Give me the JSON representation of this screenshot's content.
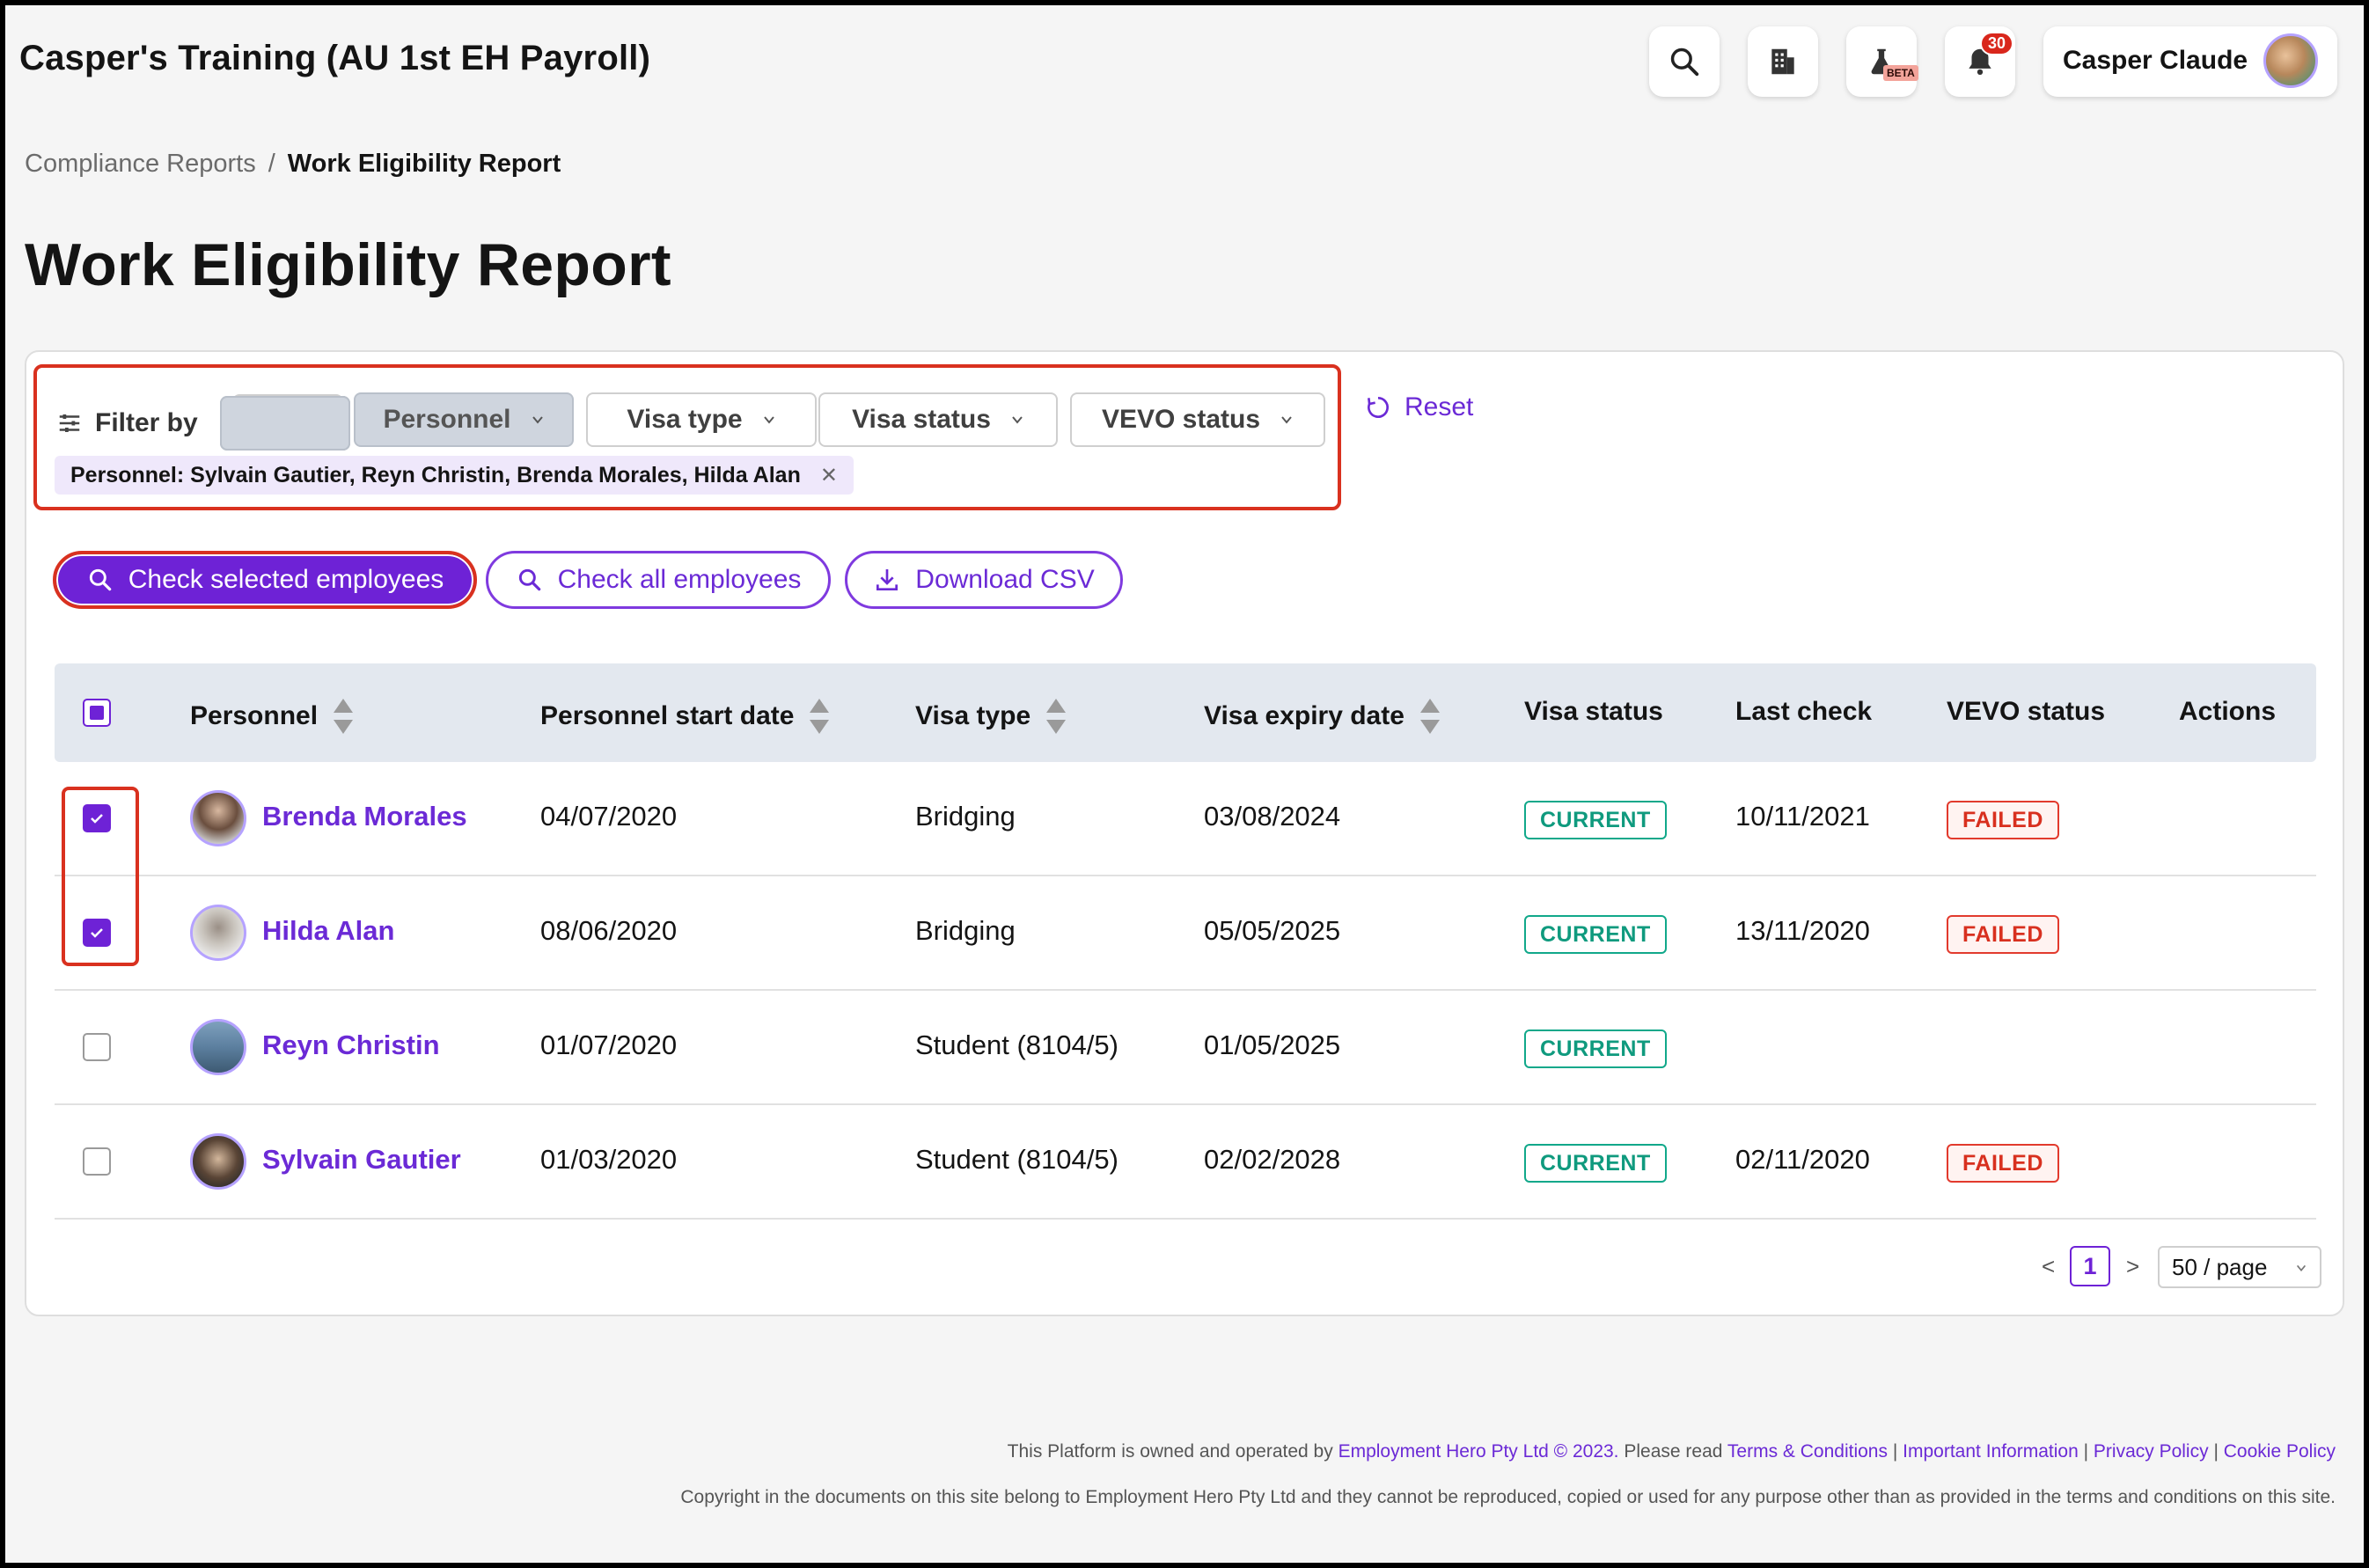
{
  "header": {
    "app_title": "Casper's Training (AU 1st EH Payroll)",
    "beta_label": "BETA",
    "notification_count": "30",
    "user_name": "Casper Claude"
  },
  "breadcrumb": {
    "parent": "Compliance Reports",
    "separator": "/",
    "current": "Work Eligibility Report"
  },
  "page": {
    "title": "Work Eligibility Report"
  },
  "filters": {
    "label": "Filter by",
    "dropdowns": [
      "Personnel",
      "Visa type",
      "Visa status",
      "VEVO status"
    ],
    "chip": "Personnel: Sylvain Gautier, Reyn Christin, Brenda Morales, Hilda Alan",
    "reset": "Reset"
  },
  "actions": {
    "check_selected": "Check selected employees",
    "check_all": "Check all employees",
    "download": "Download CSV"
  },
  "table": {
    "columns": [
      "Personnel",
      "Personnel start date",
      "Visa type",
      "Visa expiry date",
      "Visa status",
      "Last check",
      "VEVO status",
      "Actions"
    ],
    "rows": [
      {
        "name": "Brenda Morales",
        "start_date": "04/07/2020",
        "visa_type": "Bridging",
        "expiry": "03/08/2024",
        "visa_status": "CURRENT",
        "last_check": "10/11/2021",
        "vevo_status": "FAILED",
        "checked": true
      },
      {
        "name": "Hilda Alan",
        "start_date": "08/06/2020",
        "visa_type": "Bridging",
        "expiry": "05/05/2025",
        "visa_status": "CURRENT",
        "last_check": "13/11/2020",
        "vevo_status": "FAILED",
        "checked": true
      },
      {
        "name": "Reyn Christin",
        "start_date": "01/07/2020",
        "visa_type": "Student (8104/5)",
        "expiry": "01/05/2025",
        "visa_status": "CURRENT",
        "last_check": "",
        "vevo_status": "",
        "checked": false
      },
      {
        "name": "Sylvain Gautier",
        "start_date": "01/03/2020",
        "visa_type": "Student (8104/5)",
        "expiry": "02/02/2028",
        "visa_status": "CURRENT",
        "last_check": "02/11/2020",
        "vevo_status": "FAILED",
        "checked": false
      }
    ]
  },
  "pagination": {
    "prev": "<",
    "current_page": "1",
    "next": ">",
    "page_size": "50 / page"
  },
  "footer": {
    "line1_text": "This Platform is owned and operated by",
    "company_link": "Employment Hero Pty Ltd © 2023.",
    "please_read": "Please read",
    "terms": "Terms & Conditions",
    "important": "Important Information",
    "privacy": "Privacy Policy",
    "cookie": "Cookie Policy",
    "sep": "|",
    "copyright": "Copyright in the documents on this site belong to Employment Hero Pty Ltd and they cannot be reproduced, copied or used for any purpose other than as provided in the terms and conditions on this site."
  },
  "colors": {
    "accent": "#6e22d6",
    "highlight": "#d9311f",
    "current": "#11a88a",
    "failed": "#e23a2d"
  }
}
